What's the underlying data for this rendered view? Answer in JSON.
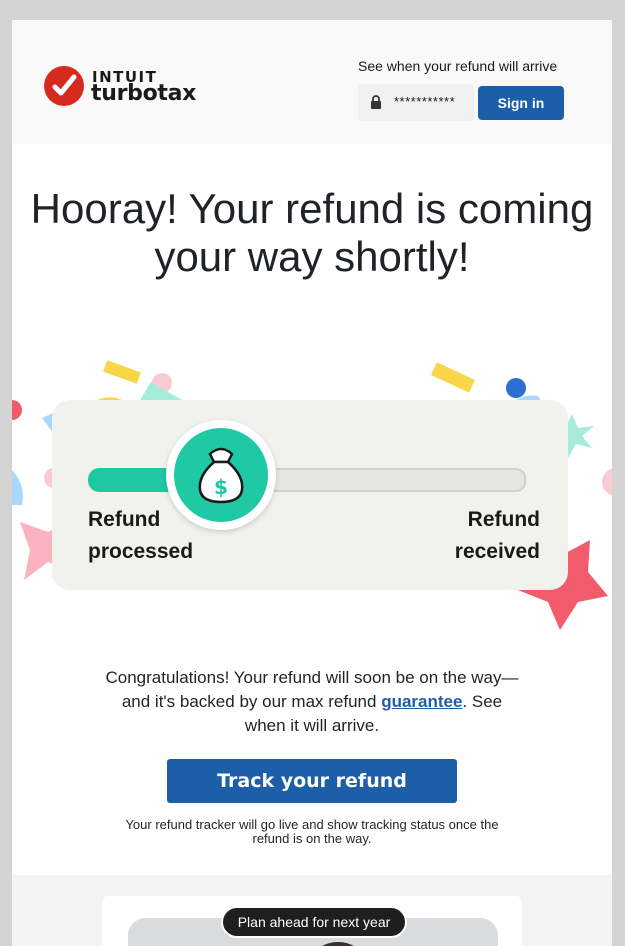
{
  "header": {
    "brand_top": "INTUIT",
    "brand_bottom": "turbotax",
    "tagline": "See when your refund will arrive",
    "password_mask": "***********",
    "sign_in_label": "Sign in"
  },
  "hero": {
    "headline": "Hooray! Your refund is coming your way shortly!",
    "step_left": "Refund processed",
    "step_right": "Refund received"
  },
  "body": {
    "message_before": "Congratulations! Your refund will soon be on the way—and it's backed by our max refund ",
    "guarantee_link": "guarantee",
    "message_after": ". See when it will arrive.",
    "cta_label": "Track your refund",
    "note": "Your refund tracker will go live and show tracking status once the refund is on the way."
  },
  "promo": {
    "pill_label": "Plan ahead for next year"
  },
  "colors": {
    "brand_red": "#d52b1e",
    "primary_blue": "#1d5ea8",
    "progress_green": "#1fc9a3"
  }
}
